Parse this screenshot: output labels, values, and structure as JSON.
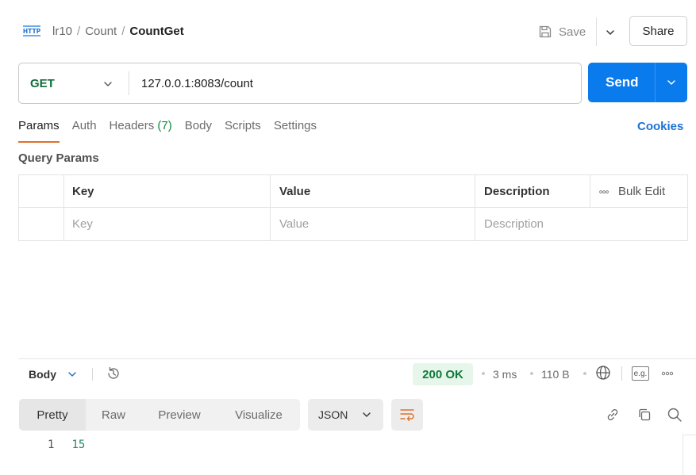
{
  "header": {
    "protocol_icon": "http-icon",
    "breadcrumb": [
      "lr10",
      "Count",
      "CountGet"
    ],
    "breadcrumb_separator": "/",
    "save_label": "Save",
    "share_label": "Share"
  },
  "request": {
    "method": "GET",
    "url": "127.0.0.1:8083/count",
    "send_label": "Send"
  },
  "tabs": {
    "items": [
      {
        "label": "Params",
        "count": ""
      },
      {
        "label": "Auth",
        "count": ""
      },
      {
        "label": "Headers",
        "count": "(7)"
      },
      {
        "label": "Body",
        "count": ""
      },
      {
        "label": "Scripts",
        "count": ""
      },
      {
        "label": "Settings",
        "count": ""
      }
    ],
    "active": "Params",
    "cookies_label": "Cookies"
  },
  "query_params": {
    "title": "Query Params",
    "columns": [
      "Key",
      "Value",
      "Description"
    ],
    "bulk_edit_label": "Bulk Edit",
    "placeholders": {
      "key": "Key",
      "value": "Value",
      "description": "Description"
    }
  },
  "response": {
    "section_label": "Body",
    "status": "200 OK",
    "time": "3 ms",
    "size": "110 B",
    "eg_label": "e.g.",
    "views": [
      "Pretty",
      "Raw",
      "Preview",
      "Visualize"
    ],
    "active_view": "Pretty",
    "format": "JSON",
    "lines": [
      {
        "number": "1",
        "value": "15"
      }
    ]
  },
  "colors": {
    "accent": "#097bed",
    "method_get": "#0f6e3a",
    "status_ok": "#0f7a39",
    "tab_underline": "#e0702a",
    "cookies_link": "#1e73d2"
  }
}
